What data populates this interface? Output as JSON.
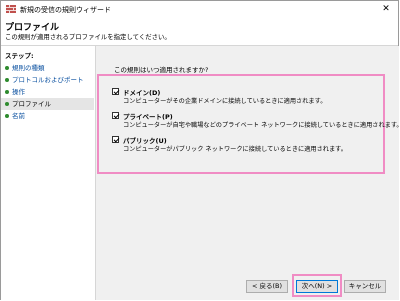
{
  "window": {
    "title": "新規の受信の規則ウィザード",
    "close_label": "✕"
  },
  "header": {
    "title": "プロファイル",
    "description": "この規則が適用されるプロファイルを指定してください。"
  },
  "sidebar": {
    "title": "ステップ:",
    "items": [
      {
        "label": "規則の種類"
      },
      {
        "label": "プロトコルおよびポート"
      },
      {
        "label": "操作"
      },
      {
        "label": "プロファイル"
      },
      {
        "label": "名前"
      }
    ],
    "current_index": 3
  },
  "main": {
    "question": "この規則はいつ適用されますか?",
    "options": [
      {
        "label": "ドメイン(D)",
        "checked": true,
        "description": "コンピューターがその企業ドメインに接続しているときに適用されます。"
      },
      {
        "label": "プライベート(P)",
        "checked": true,
        "description": "コンピューターが自宅や職場などのプライベート ネットワークに接続しているときに適用されます。"
      },
      {
        "label": "パブリック(U)",
        "checked": true,
        "description": "コンピューターがパブリック ネットワークに接続しているときに適用されます。"
      }
    ]
  },
  "buttons": {
    "back": "< 戻る(B)",
    "next": "次へ(N) >",
    "cancel": "キャンセル"
  },
  "colors": {
    "highlight": "#f08cc4",
    "step_dot": "#2e8b2e",
    "link": "#0a50a0"
  }
}
